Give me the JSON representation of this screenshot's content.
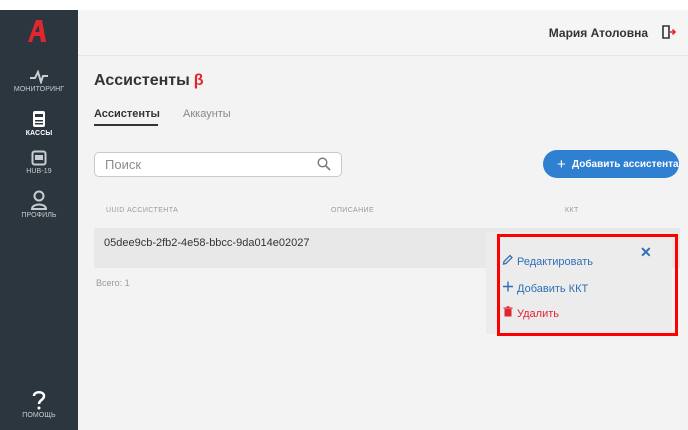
{
  "header": {
    "user_name": "Мария Атоловна"
  },
  "sidebar": {
    "logo_letter": "А",
    "items": [
      {
        "label": "МОНИТОРИНГ",
        "icon": "pulse-icon"
      },
      {
        "label": "КАССЫ",
        "icon": "cash-register-icon",
        "active": true
      },
      {
        "label": "HUB-19",
        "icon": "hub-icon"
      },
      {
        "label": "ПРОФИЛЬ",
        "icon": "user-icon"
      },
      {
        "label": "ПОМОЩЬ",
        "icon": "help-icon"
      }
    ]
  },
  "main": {
    "title": "Ассистенты",
    "beta": "β",
    "tabs": [
      {
        "label": "Ассистенты",
        "active": true
      },
      {
        "label": "Аккаунты"
      }
    ],
    "search": {
      "placeholder": "Поиск"
    },
    "add_button": {
      "plus": "+",
      "label": "Добавить ассистента"
    },
    "table": {
      "columns": [
        "UUID АССИСТЕНТА",
        "ОПИСАНИЕ",
        "ККТ"
      ],
      "rows": [
        {
          "uuid": "05dee9cb-2fb2-4e58-bbcc-9da014e02027"
        }
      ],
      "total": "Всего: 1"
    },
    "menu": {
      "close": "✕",
      "edit": "Редактировать",
      "add": "Добавить ККТ",
      "delete": "Удалить"
    }
  },
  "colors": {
    "accent": "#2f80d1",
    "brand": "#e0262f",
    "sidebar": "#2c363f",
    "highlight": "#ff0000"
  }
}
